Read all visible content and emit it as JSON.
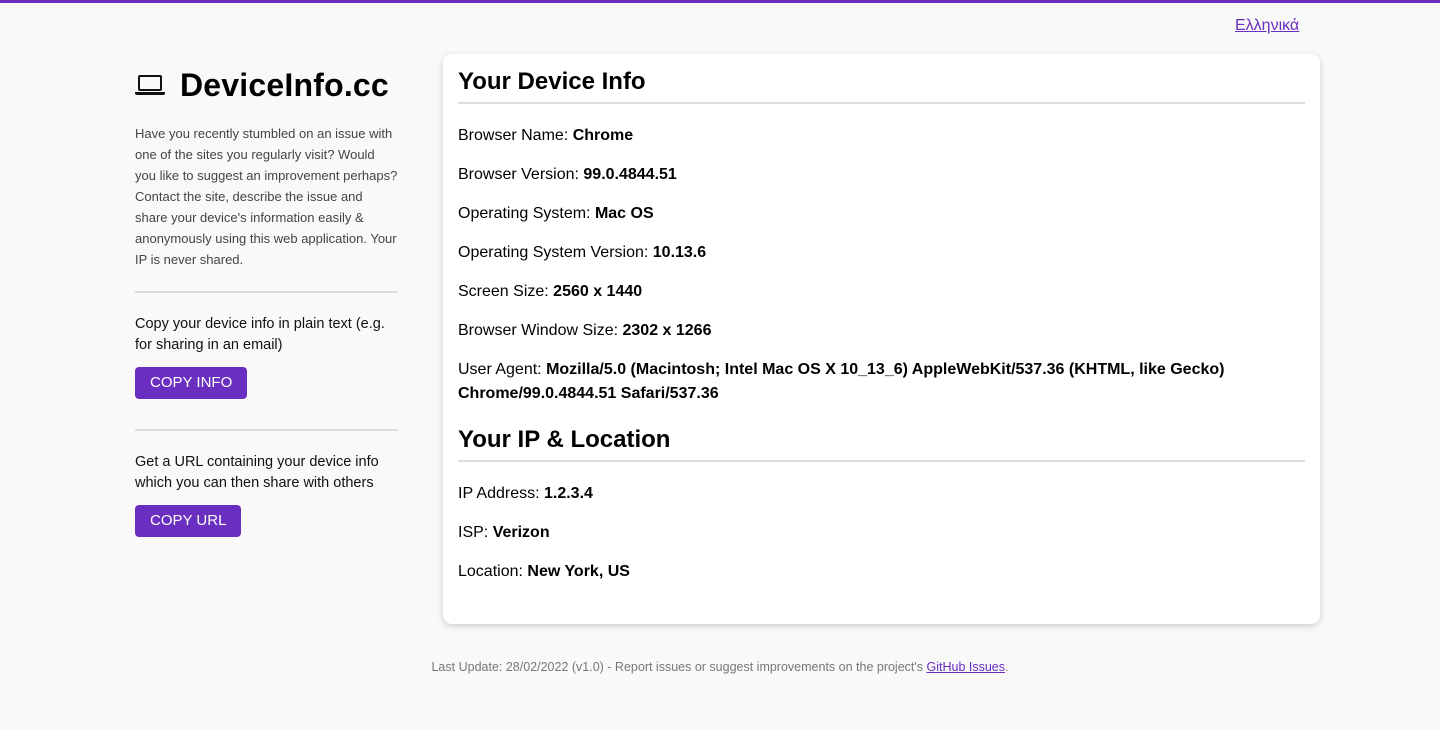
{
  "language_link": "Ελληνικά",
  "app": {
    "title": "DeviceInfo.cc",
    "logo_icon": "laptop-icon",
    "intro": "Have you recently stumbled on an issue with one of the sites you regularly visit? Would you like to suggest an improvement perhaps? Contact the site, describe the issue and share your device's information easily & anonymously using this web application. Your IP is never shared."
  },
  "copy_info": {
    "help": "Copy your device info in plain text (e.g. for sharing in an email)",
    "button": "COPY INFO"
  },
  "copy_url": {
    "help": "Get a URL containing your device info which you can then share with others",
    "button": "COPY URL"
  },
  "device_section": {
    "title": "Your Device Info",
    "rows": [
      {
        "label": "Browser Name:",
        "value": "Chrome"
      },
      {
        "label": "Browser Version:",
        "value": "99.0.4844.51"
      },
      {
        "label": "Operating System:",
        "value": "Mac OS"
      },
      {
        "label": "Operating System Version:",
        "value": "10.13.6"
      },
      {
        "label": "Screen Size:",
        "value": "2560 x 1440"
      },
      {
        "label": "Browser Window Size:",
        "value": "2302 x 1266"
      },
      {
        "label": "User Agent:",
        "value": "Mozilla/5.0 (Macintosh; Intel Mac OS X 10_13_6) AppleWebKit/537.36 (KHTML, like Gecko) Chrome/99.0.4844.51 Safari/537.36"
      }
    ]
  },
  "ip_section": {
    "title": "Your IP & Location",
    "rows": [
      {
        "label": "IP Address:",
        "value": "1.2.3.4"
      },
      {
        "label": "ISP:",
        "value": "Verizon"
      },
      {
        "label": "Location:",
        "value": "New York, US"
      }
    ]
  },
  "footer": {
    "text": "Last Update: 28/02/2022 (v1.0) - Report issues or suggest improvements on the project's ",
    "link": "GitHub Issues",
    "end": "."
  },
  "colors": {
    "accent": "#6a2fc0",
    "background": "#f9f9f9"
  }
}
